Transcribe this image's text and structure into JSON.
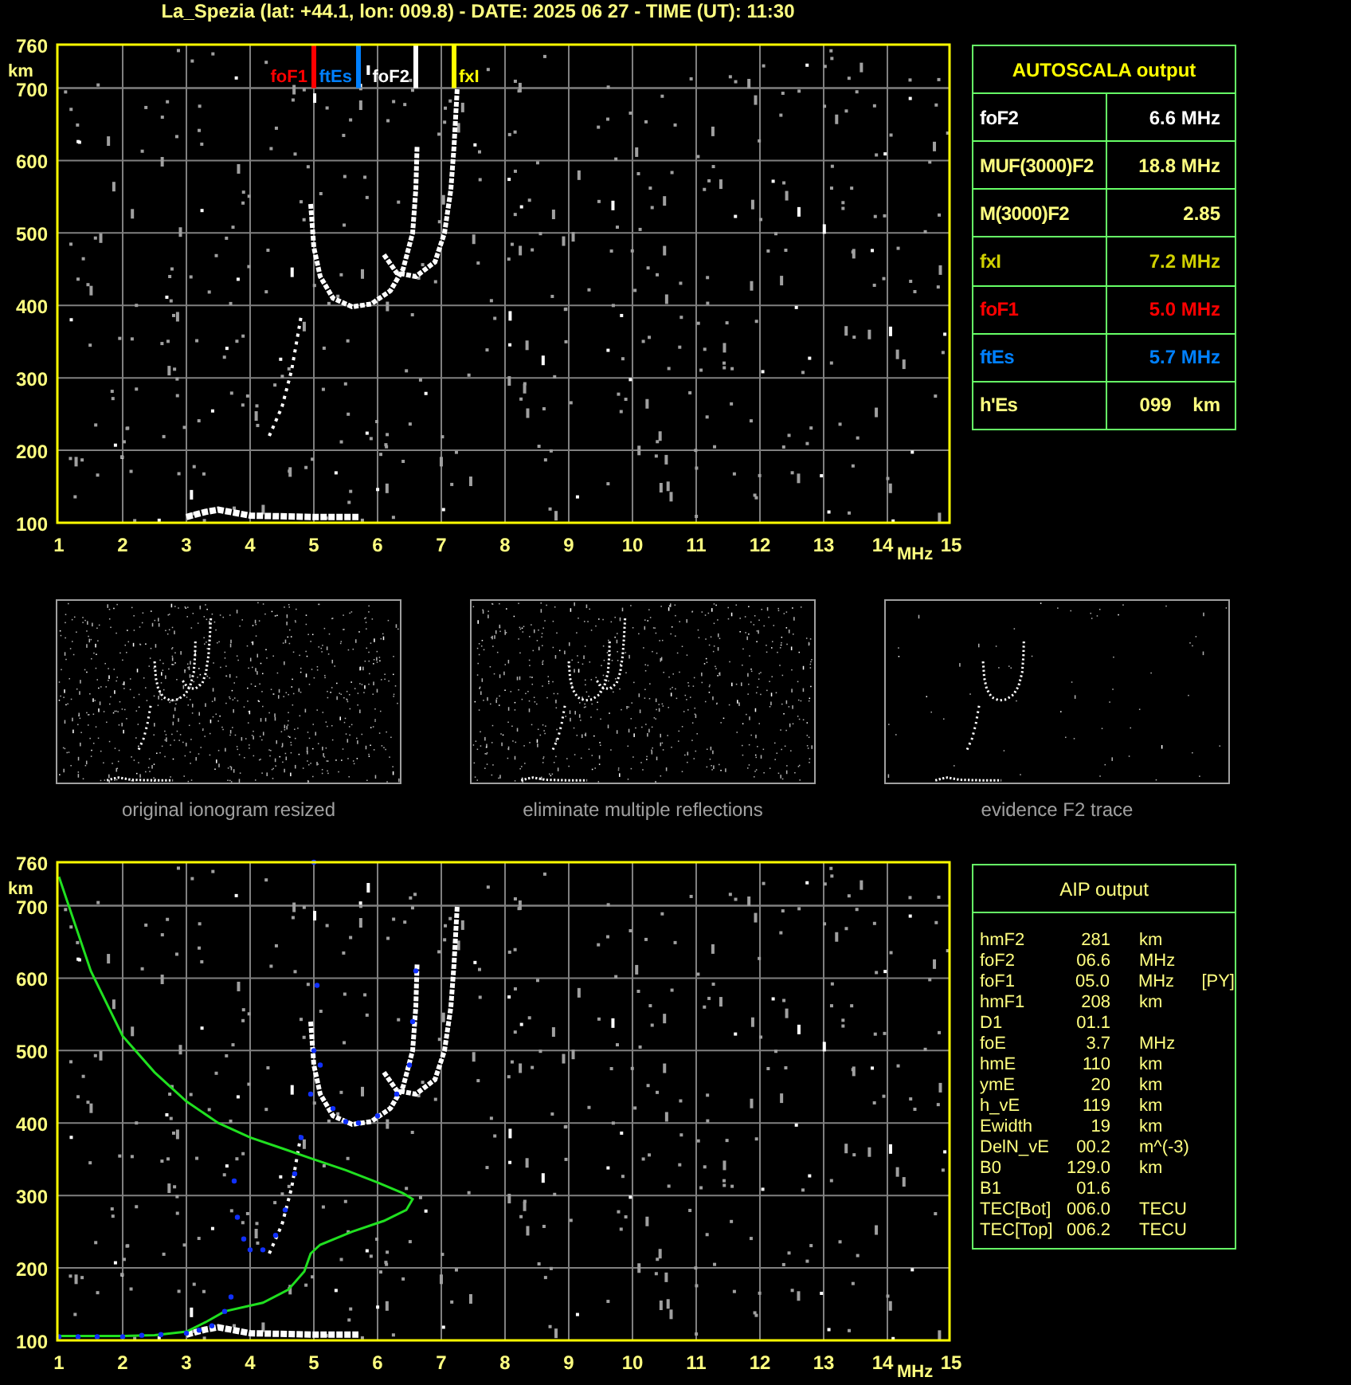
{
  "title": "La_Spezia (lat: +44.1, lon: 009.8) - DATE: 2025 06 27 - TIME (UT): 11:30",
  "top_ionogram": {
    "y_labels": [
      "760",
      "700",
      "600",
      "500",
      "400",
      "300",
      "200",
      "100"
    ],
    "y_unit": "km",
    "x_labels": [
      "1",
      "2",
      "3",
      "4",
      "5",
      "6",
      "7",
      "8",
      "9",
      "10",
      "11",
      "12",
      "13",
      "14",
      "15"
    ],
    "x_unit": "MHz",
    "markers": [
      {
        "label": "foF1",
        "color": "#ff0000"
      },
      {
        "label": "ftEs",
        "color": "#0080ff"
      },
      {
        "label": "foF2",
        "color": "#ffffff"
      },
      {
        "label": "fxI",
        "color": "#ffff00"
      }
    ]
  },
  "autoscala": {
    "title": "AUTOSCALA output",
    "rows": [
      {
        "name": "foF2",
        "value": "6.6 MHz",
        "color": "#ffffff"
      },
      {
        "name": "MUF(3000)F2",
        "value": "18.8 MHz",
        "color": "#ffff80"
      },
      {
        "name": "M(3000)F2",
        "value": "2.85",
        "color": "#ffff80"
      },
      {
        "name": "fxI",
        "value": "7.2 MHz",
        "color": "#d0d000"
      },
      {
        "name": "foF1",
        "value": "5.0 MHz",
        "color": "#ff0000"
      },
      {
        "name": "ftEs",
        "value": "5.7 MHz",
        "color": "#0080ff"
      },
      {
        "name": "h'Es",
        "value": "099    km",
        "color": "#ffff80"
      }
    ]
  },
  "thumbnails": [
    {
      "kind": "raw",
      "caption": "original ionogram resized"
    },
    {
      "kind": "cleaned",
      "caption": "eliminate multiple reflections"
    },
    {
      "kind": "trace",
      "caption": "evidence F2 trace"
    }
  ],
  "aip_ionogram": {
    "y_labels": [
      "760",
      "700",
      "600",
      "500",
      "400",
      "300",
      "200",
      "100"
    ],
    "y_unit": "km",
    "x_labels": [
      "1",
      "2",
      "3",
      "4",
      "5",
      "6",
      "7",
      "8",
      "9",
      "10",
      "11",
      "12",
      "13",
      "14",
      "15"
    ],
    "x_unit": "MHz"
  },
  "aip": {
    "title": "AIP output",
    "rows": [
      {
        "name": "hmF2",
        "value": "281",
        "unit": "km"
      },
      {
        "name": "foF2",
        "value": "06.6",
        "unit": "MHz"
      },
      {
        "name": "foF1",
        "value": "05.0",
        "unit": "MHz",
        "note": "[PY]"
      },
      {
        "name": "hmF1",
        "value": "208",
        "unit": "km"
      },
      {
        "name": "D1",
        "value": "01.1"
      },
      {
        "name": "foE",
        "value": "3.7",
        "unit": "MHz"
      },
      {
        "name": "hmE",
        "value": "110",
        "unit": "km"
      },
      {
        "name": "ymE",
        "value": "20",
        "unit": "km"
      },
      {
        "name": "h_vE",
        "value": "119",
        "unit": "km"
      },
      {
        "name": "Ewidth",
        "value": "19",
        "unit": "km"
      },
      {
        "name": "DelN_vE",
        "value": "00.2",
        "unit": "m^(-3)"
      },
      {
        "name": "B0",
        "value": "129.0",
        "unit": "km"
      },
      {
        "name": "B1",
        "value": "01.6"
      },
      {
        "name": "TEC[Bot]",
        "value": "006.0",
        "unit": "TECU"
      },
      {
        "name": "TEC[Top]",
        "value": "006.2",
        "unit": "TECU"
      }
    ]
  }
}
